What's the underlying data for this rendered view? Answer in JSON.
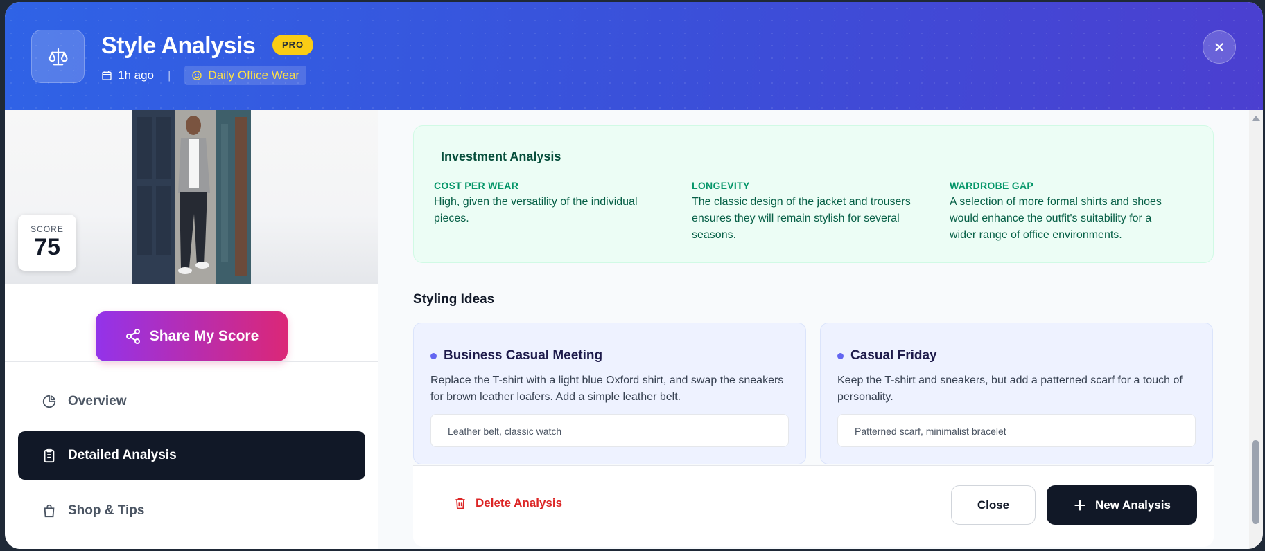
{
  "header": {
    "title": "Style Analysis",
    "badge": "PRO",
    "time": "1h ago",
    "separator": "|",
    "occasion": "Daily Office Wear"
  },
  "sidebar": {
    "score_label": "SCORE",
    "score_value": "75",
    "share_label": "Share My Score",
    "nav": [
      {
        "label": "Overview",
        "icon": "pie-chart-icon"
      },
      {
        "label": "Detailed Analysis",
        "icon": "clipboard-icon"
      },
      {
        "label": "Shop & Tips",
        "icon": "shopping-bag-icon"
      }
    ],
    "active_nav": "Detailed Analysis"
  },
  "investment": {
    "title": "Investment Analysis",
    "items": [
      {
        "key": "COST PER WEAR",
        "value": "High, given the versatility of the individual pieces."
      },
      {
        "key": "LONGEVITY",
        "value": "The classic design of the jacket and trousers ensures they will remain stylish for several seasons."
      },
      {
        "key": "WARDROBE GAP",
        "value": "A selection of more formal shirts and shoes would enhance the outfit's suitability for a wider range of office environments."
      }
    ]
  },
  "styling": {
    "title": "Styling Ideas",
    "ideas": [
      {
        "title": "Business Casual Meeting",
        "desc": "Replace the T-shirt with a light blue Oxford shirt, and swap the sneakers for brown leather loafers. Add a simple leather belt.",
        "tag": "Leather belt, classic watch"
      },
      {
        "title": "Casual Friday",
        "desc": "Keep the T-shirt and sneakers, but add a patterned scarf for a touch of personality.",
        "tag": "Patterned scarf, minimalist bracelet"
      }
    ]
  },
  "footer": {
    "delete_label": "Delete Analysis",
    "close_label": "Close",
    "new_label": "New Analysis"
  },
  "colors": {
    "header_start": "#2f63e6",
    "header_end": "#4b3fd0",
    "badge": "#facc15",
    "share_start": "#9333ea",
    "share_end": "#db2777",
    "danger": "#dc2626"
  }
}
